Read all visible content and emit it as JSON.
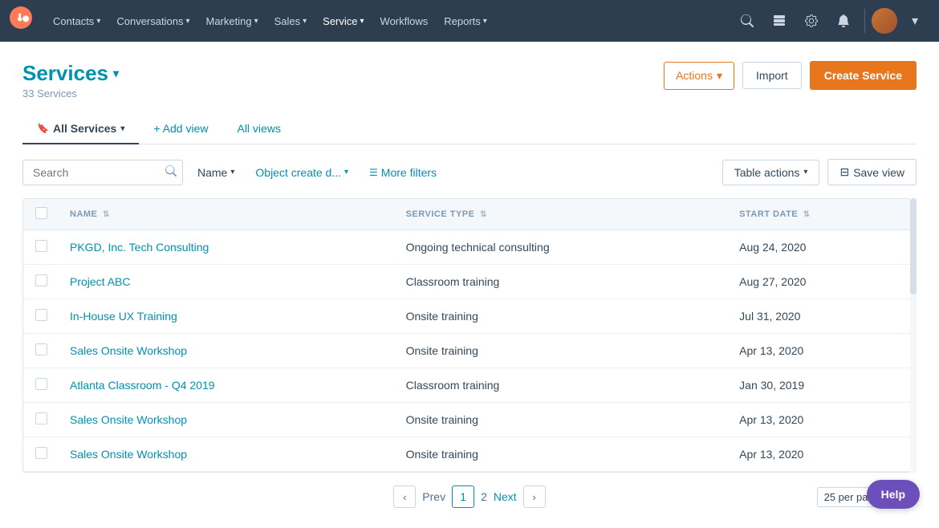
{
  "topnav": {
    "items": [
      {
        "label": "Contacts",
        "has_dropdown": true
      },
      {
        "label": "Conversations",
        "has_dropdown": true
      },
      {
        "label": "Marketing",
        "has_dropdown": true
      },
      {
        "label": "Sales",
        "has_dropdown": true
      },
      {
        "label": "Service",
        "has_dropdown": true
      },
      {
        "label": "Workflows",
        "has_dropdown": false
      },
      {
        "label": "Reports",
        "has_dropdown": true
      }
    ]
  },
  "page": {
    "title": "Services",
    "subtitle": "33 Services"
  },
  "header_buttons": {
    "actions": "Actions",
    "import": "Import",
    "create": "Create Service"
  },
  "tabs": [
    {
      "label": "All Services",
      "active": true,
      "icon": "bookmark"
    },
    {
      "label": "+ Add view",
      "active": false,
      "style": "add"
    },
    {
      "label": "All views",
      "active": false,
      "style": "link"
    }
  ],
  "filters": {
    "search_placeholder": "Search",
    "name_filter": "Name",
    "object_filter": "Object create d...",
    "more_filters": "More filters",
    "table_actions": "Table actions",
    "save_view": "Save view"
  },
  "table": {
    "columns": [
      {
        "key": "name",
        "label": "NAME"
      },
      {
        "key": "service_type",
        "label": "SERVICE TYPE"
      },
      {
        "key": "start_date",
        "label": "START DATE"
      }
    ],
    "rows": [
      {
        "name": "PKGD, Inc. Tech Consulting",
        "service_type": "Ongoing technical consulting",
        "start_date": "Aug 24, 2020"
      },
      {
        "name": "Project ABC",
        "service_type": "Classroom training",
        "start_date": "Aug 27, 2020"
      },
      {
        "name": "In-House UX Training",
        "service_type": "Onsite training",
        "start_date": "Jul 31, 2020"
      },
      {
        "name": "Sales Onsite Workshop",
        "service_type": "Onsite training",
        "start_date": "Apr 13, 2020"
      },
      {
        "name": "Atlanta Classroom - Q4 2019",
        "service_type": "Classroom training",
        "start_date": "Jan 30, 2019"
      },
      {
        "name": "Sales Onsite Workshop",
        "service_type": "Onsite training",
        "start_date": "Apr 13, 2020"
      },
      {
        "name": "Sales Onsite Workshop",
        "service_type": "Onsite training",
        "start_date": "Apr 13, 2020"
      }
    ]
  },
  "pagination": {
    "prev": "Prev",
    "current_page": "1",
    "next_page": "2",
    "next": "Next",
    "per_page": "25 per page"
  },
  "help": "Help"
}
